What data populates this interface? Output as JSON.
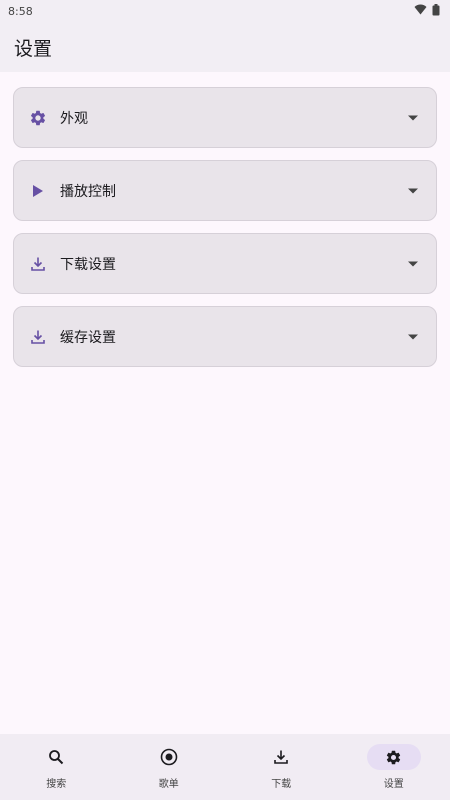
{
  "status_bar": {
    "time": "8:58",
    "wifi_icon": "wifi-icon",
    "battery_icon": "battery-icon"
  },
  "app_bar": {
    "title": "设置"
  },
  "accent_color": "#6750a4",
  "sections": [
    {
      "label": "外观",
      "icon": "gear-icon"
    },
    {
      "label": "播放控制",
      "icon": "play-icon"
    },
    {
      "label": "下载设置",
      "icon": "download-icon"
    },
    {
      "label": "缓存设置",
      "icon": "download-icon"
    }
  ],
  "bottom_nav": {
    "items": [
      {
        "label": "搜索",
        "icon": "search-icon",
        "active": false
      },
      {
        "label": "歌单",
        "icon": "record-icon",
        "active": false
      },
      {
        "label": "下载",
        "icon": "download-icon",
        "active": false
      },
      {
        "label": "设置",
        "icon": "gear-icon",
        "active": true
      }
    ]
  }
}
